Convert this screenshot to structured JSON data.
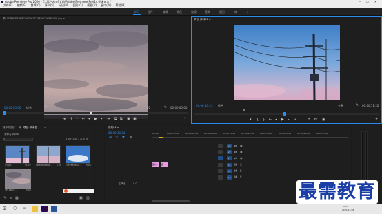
{
  "app": {
    "title": "Adobe Premiere Pro 2020 - C:\\用户\\Arui\\文档\\Adobe\\Premiere Pro\\14.0\\未命名 *",
    "window_controls": [
      "—",
      "☐",
      "✕"
    ]
  },
  "menu": [
    "文件(F)",
    "编辑(E)",
    "剪辑(C)",
    "序列(S)",
    "标记(M)",
    "图形(G)",
    "视图(V)",
    "窗口(W)",
    "帮助(H)"
  ],
  "workspaces": {
    "items": [
      "学习",
      "组件",
      "编辑",
      "颜色",
      "效果",
      "音频",
      "图形",
      "库"
    ],
    "active_index": 0,
    "more": "»"
  },
  "source_monitor": {
    "tab": "源: 0DB6BDE3B8C0A75C1C79F6CC8CE6F4F8.jpg  ≡",
    "timecode": "00:00:05:00",
    "fit": "适合",
    "quality": "1/2",
    "duration": "00:00:05:00",
    "controls": [
      "◂",
      "{",
      "}",
      "⇤",
      "◂",
      "▶",
      "▸",
      "⇥",
      "⧉",
      "⧉",
      "▣",
      "▣",
      "+"
    ]
  },
  "program_monitor": {
    "tab": "节目: 序列01  ≡",
    "timecode": "00:00:10:24",
    "fit": "适合",
    "quality": "完整",
    "duration": "00:00:11:22",
    "controls": [
      "▾",
      "{",
      "}",
      "⇤",
      "◂",
      "▶",
      "▸",
      "⇥",
      "⧉",
      "⧉",
      "▣",
      "+"
    ]
  },
  "project_panel": {
    "tabs": [
      "媒体浏览器",
      "库",
      "信息",
      "效果",
      "项目: 未命名",
      "≡"
    ],
    "path": "未命名.prproj",
    "item_count": "1 项已选择，共 4 项",
    "items": [
      {
        "name": "序列01",
        "duration": "11:22"
      },
      {
        "name": "0DB6BDE3B8...",
        "duration": "5:00"
      },
      {
        "name": "C9EF8BF80A...",
        "duration": "5:00"
      },
      {
        "name": "4E1CBA3...",
        "duration": "5:00"
      }
    ]
  },
  "timeline": {
    "tab": "序列01  ≡",
    "timecode": "00:00:10:24",
    "ruler": [
      "00:00",
      "00:00:05:00",
      "00:00:10:00",
      "00:00:15:00",
      "00:00:20:00",
      "00:00:25:00",
      "00:00:30:00",
      "00:00:35:00",
      "00:00:40:00",
      "00:00:45:00"
    ],
    "video_tracks": [
      "V3",
      "V2",
      "V1"
    ],
    "audio_tracks": [
      "A1",
      "A2",
      "A3"
    ],
    "master": "主声道",
    "master_value": "0.0",
    "clips": [
      {
        "label": "图片"
      },
      {
        "label": "图"
      }
    ]
  },
  "taskbar": {
    "time": "8:54",
    "date": "2021/12/28"
  },
  "watermark": "最需教育"
}
